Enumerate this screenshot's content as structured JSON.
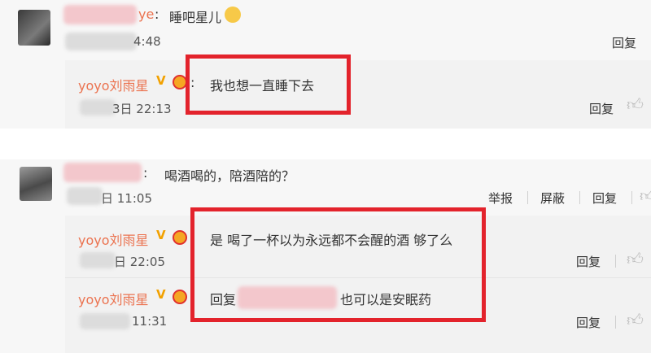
{
  "c1": {
    "username_tail": "ye",
    "text": "睡吧星儿",
    "emoji_icon": "crying-face-emoji",
    "time": "4:48",
    "reply_label": "回复",
    "sub": {
      "username": "yoyo刘雨星",
      "text": "我也想一直睡下去",
      "time": "3日 22:13",
      "reply_label": "回复"
    }
  },
  "c2": {
    "text": "喝酒喝的，陪酒陪的？",
    "time": "日 11:05",
    "report_label": "举报",
    "block_label": "屏蔽",
    "reply_label": "回复",
    "sub1": {
      "username": "yoyo刘雨星",
      "text": "是 喝了一杯以为永远都不会醒的酒 够了么",
      "time": "日 22:05",
      "reply_label": "回复"
    },
    "sub2": {
      "username": "yoyo刘雨星",
      "reply_prefix": "回复",
      "text": "也可以是安眠药",
      "time": "11:31",
      "reply_label": "回复"
    }
  },
  "colors": {
    "highlight": "#e3232c",
    "username": "#eb7350",
    "verified": "#f2a100"
  }
}
